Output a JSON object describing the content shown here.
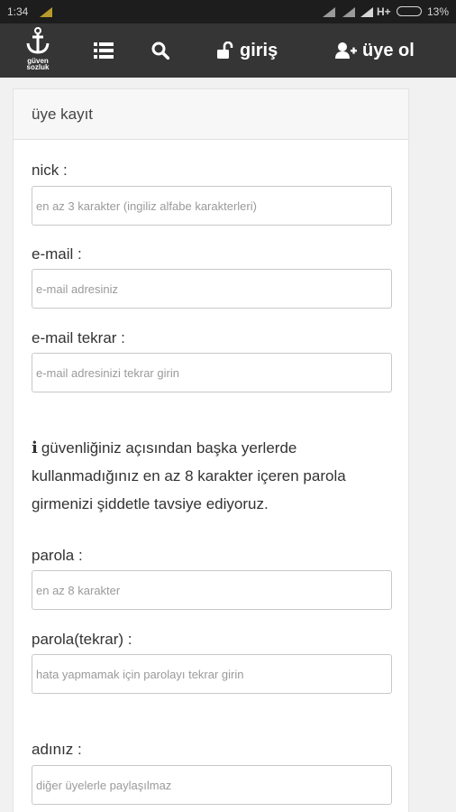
{
  "status_bar": {
    "time": "1:34",
    "network": "H+",
    "battery": "13%"
  },
  "nav": {
    "logo_line1": "güven",
    "logo_line2": "sozluk",
    "login_label": "giriş",
    "register_label": "üye ol"
  },
  "panel": {
    "title": "üye kayıt"
  },
  "form": {
    "nick_label": "nick :",
    "nick_placeholder": "en az 3 karakter (ingiliz alfabe karakterleri)",
    "email_label": "e-mail :",
    "email_placeholder": "e-mail adresiniz",
    "email_repeat_label": "e-mail tekrar :",
    "email_repeat_placeholder": "e-mail adresinizi tekrar girin",
    "info_text": "güvenliğiniz açısından başka yerlerde kullanmadığınız en az 8 karakter içeren parola girmenizi şiddetle tavsiye ediyoruz.",
    "password_label": "parola :",
    "password_placeholder": "en az 8 karakter",
    "password_repeat_label": "parola(tekrar) :",
    "password_repeat_placeholder": "hata yapmamak için parolayı tekrar girin",
    "name_label": "adınız :",
    "name_placeholder": "diğer üyelerle paylaşılmaz"
  }
}
